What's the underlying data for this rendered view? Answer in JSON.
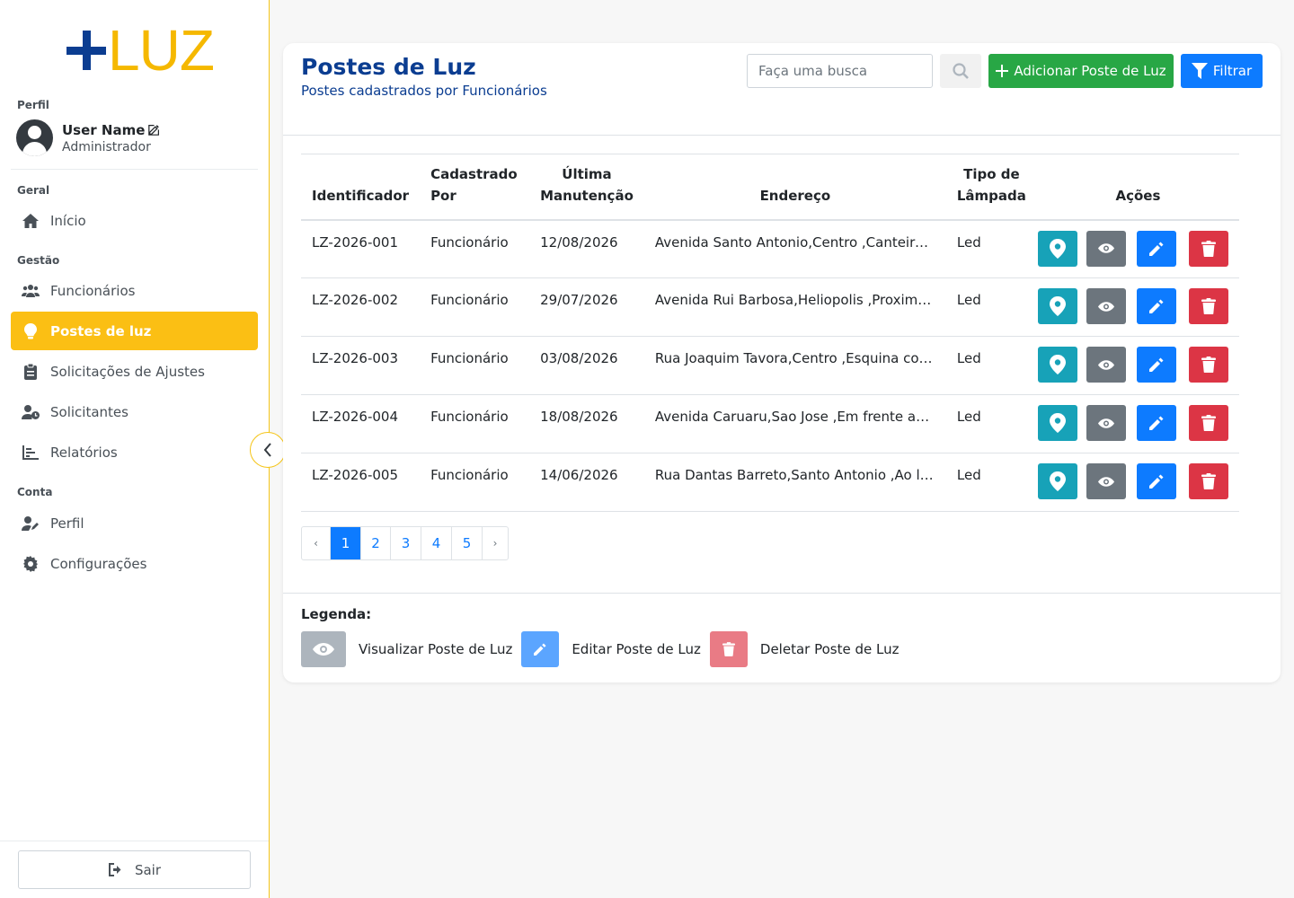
{
  "sidebar": {
    "logo": {
      "plus": "+",
      "text": "LUZ"
    },
    "profile_label": "Perfil",
    "user": {
      "name": "User Name",
      "role": "Administrador"
    },
    "sections": {
      "geral": "Geral",
      "gestao": "Gestão",
      "conta": "Conta"
    },
    "items": {
      "inicio": "Início",
      "funcionarios": "Funcionários",
      "postes": "Postes de luz",
      "solicitacoes": "Solicitações de Ajustes",
      "solicitantes": "Solicitantes",
      "relatorios": "Relatórios",
      "perfil": "Perfil",
      "configuracoes": "Configurações"
    },
    "logout": "Sair",
    "active_item": "postes"
  },
  "header": {
    "title": "Postes de Luz",
    "subtitle": "Postes cadastrados por Funcionários",
    "search_placeholder": "Faça uma busca",
    "add_button": "Adicionar Poste de Luz",
    "filter_button": "Filtrar"
  },
  "table": {
    "columns": {
      "id": "Identificador",
      "by": "Cadastrado Por",
      "maint_line1": "Última",
      "maint_line2": "Manutenção",
      "address": "Endereço",
      "lamp_line1": "Tipo de",
      "lamp_line2": "Lâmpada",
      "actions": "Ações"
    },
    "rows": [
      {
        "id": "LZ-2026-001",
        "by": "Funcionário",
        "maint": "12/08/2026",
        "address": "Avenida Santo Antonio,Centro ,Canteiro c...",
        "lamp": "Led"
      },
      {
        "id": "LZ-2026-002",
        "by": "Funcionário",
        "maint": "29/07/2026",
        "address": "Avenida Rui Barbosa,Heliopolis ,Proximo a...",
        "lamp": "Led"
      },
      {
        "id": "LZ-2026-003",
        "by": "Funcionário",
        "maint": "03/08/2026",
        "address": "Rua Joaquim Tavora,Centro ,Esquina com ...",
        "lamp": "Led"
      },
      {
        "id": "LZ-2026-004",
        "by": "Funcionário",
        "maint": "18/08/2026",
        "address": "Avenida Caruaru,Sao Jose ,Em frente ao p...",
        "lamp": "Led"
      },
      {
        "id": "LZ-2026-005",
        "by": "Funcionário",
        "maint": "14/06/2026",
        "address": "Rua Dantas Barreto,Santo Antonio ,Ao lad...",
        "lamp": "Led"
      }
    ]
  },
  "pagination": {
    "prev": "‹",
    "next": "›",
    "pages": [
      "1",
      "2",
      "3",
      "4",
      "5"
    ],
    "current": "1"
  },
  "legend": {
    "title": "Legenda:",
    "view": "Visualizar Poste de Luz",
    "edit": "Editar Poste de Luz",
    "delete": "Deletar Poste de Luz"
  },
  "icons": {
    "location": "map-marker-icon",
    "view": "eye-icon",
    "edit": "pencil-icon",
    "delete": "trash-icon"
  },
  "colors": {
    "brand_blue": "#0b3d91",
    "brand_yellow": "#f5b800",
    "active_nav": "#fbbf14",
    "success": "#28a745",
    "primary": "#0d7bff",
    "info": "#17a2b8",
    "secondary": "#6c757d",
    "danger": "#dc3545"
  }
}
